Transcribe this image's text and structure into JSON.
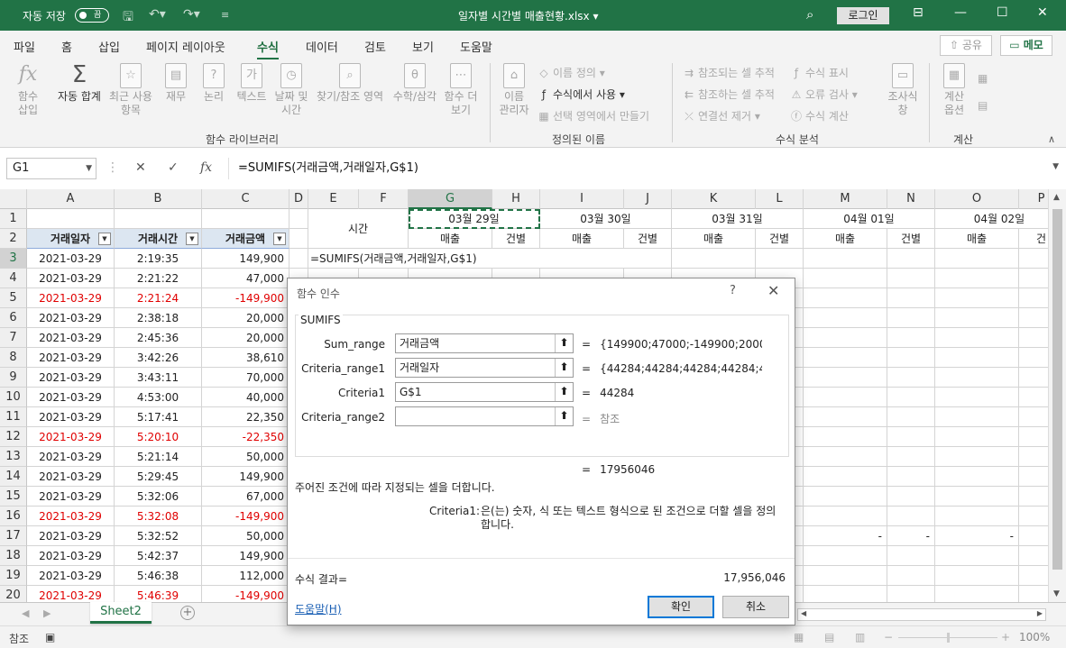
{
  "titlebar": {
    "autosave_label": "자동 저장",
    "autosave_state": "끔",
    "doc_title": "일자별 시간별 매출현황.xlsx ▾",
    "login": "로그인"
  },
  "tabs": [
    "파일",
    "홈",
    "삽입",
    "페이지 레이아웃",
    "수식",
    "데이터",
    "검토",
    "보기",
    "도움말"
  ],
  "active_tab": "수식",
  "share_label": "공유",
  "memo_label": "메모",
  "ribbon": {
    "insert_fn": "함수\n삽입",
    "autosum": "자동 합계",
    "recent": "최근 사용\n항목",
    "finance": "재무",
    "logic": "논리",
    "text": "텍스트",
    "datetime": "날짜 및\n시간",
    "lookup": "찾기/참조 영역",
    "math": "수학/삼각",
    "more": "함수 더\n보기",
    "group1": "함수 라이브러리",
    "name_mgr": "이름\n관리자",
    "define_name": "이름 정의",
    "use_in_formula": "수식에서 사용",
    "create_from_sel": "선택 영역에서 만들기",
    "group2": "정의된 이름",
    "trace_prec": "참조되는 셀 추적",
    "trace_dep": "참조하는 셀 추적",
    "remove_arrows": "연결선 제거",
    "show_formulas": "수식 표시",
    "error_check": "오류 검사",
    "evaluate": "수식 계산",
    "watch": "조사식\n창",
    "group3": "수식 분석",
    "calc_options": "계산\n옵션",
    "group4": "계산"
  },
  "formula_bar": {
    "name_box": "G1",
    "formula": "=SUMIFS(거래금액,거래일자,G$1)"
  },
  "columns": [
    "A",
    "B",
    "C",
    "D",
    "E",
    "F",
    "G",
    "H",
    "I",
    "J",
    "K",
    "L",
    "M",
    "N",
    "O",
    "P"
  ],
  "selected_column": "G",
  "header_row": {
    "time_label": "시간",
    "dates": [
      "03월 29일",
      "03월 30일",
      "03월 31일",
      "04월 01일",
      "04월 02일"
    ],
    "sales": "매출",
    "count": "건별",
    "count_partial": "건"
  },
  "table_headers": [
    "거래일자",
    "거래시간",
    "거래금액"
  ],
  "editing_cell_text": "=SUMIFS(거래금액,거래일자,G$1)",
  "rows": [
    {
      "n": "3",
      "date": "2021-03-29",
      "time": "2:19:35",
      "amt": "149,900",
      "neg": false
    },
    {
      "n": "4",
      "date": "2021-03-29",
      "time": "2:21:22",
      "amt": "47,000",
      "neg": false
    },
    {
      "n": "5",
      "date": "2021-03-29",
      "time": "2:21:24",
      "amt": "-149,900",
      "neg": true
    },
    {
      "n": "6",
      "date": "2021-03-29",
      "time": "2:38:18",
      "amt": "20,000",
      "neg": false
    },
    {
      "n": "7",
      "date": "2021-03-29",
      "time": "2:45:36",
      "amt": "20,000",
      "neg": false
    },
    {
      "n": "8",
      "date": "2021-03-29",
      "time": "3:42:26",
      "amt": "38,610",
      "neg": false
    },
    {
      "n": "9",
      "date": "2021-03-29",
      "time": "3:43:11",
      "amt": "70,000",
      "neg": false
    },
    {
      "n": "10",
      "date": "2021-03-29",
      "time": "4:53:00",
      "amt": "40,000",
      "neg": false
    },
    {
      "n": "11",
      "date": "2021-03-29",
      "time": "5:17:41",
      "amt": "22,350",
      "neg": false
    },
    {
      "n": "12",
      "date": "2021-03-29",
      "time": "5:20:10",
      "amt": "-22,350",
      "neg": true
    },
    {
      "n": "13",
      "date": "2021-03-29",
      "time": "5:21:14",
      "amt": "50,000",
      "neg": false
    },
    {
      "n": "14",
      "date": "2021-03-29",
      "time": "5:29:45",
      "amt": "149,900",
      "neg": false
    },
    {
      "n": "15",
      "date": "2021-03-29",
      "time": "5:32:06",
      "amt": "67,000",
      "neg": false
    },
    {
      "n": "16",
      "date": "2021-03-29",
      "time": "5:32:08",
      "amt": "-149,900",
      "neg": true
    },
    {
      "n": "17",
      "date": "2021-03-29",
      "time": "5:32:52",
      "amt": "50,000",
      "neg": false
    },
    {
      "n": "18",
      "date": "2021-03-29",
      "time": "5:42:37",
      "amt": "149,900",
      "neg": false
    },
    {
      "n": "19",
      "date": "2021-03-29",
      "time": "5:46:38",
      "amt": "112,000",
      "neg": false
    },
    {
      "n": "20",
      "date": "2021-03-29",
      "time": "5:46:39",
      "amt": "-149,900",
      "neg": true
    }
  ],
  "row17_dashes": [
    "-",
    "-",
    "-"
  ],
  "dialog": {
    "title": "함수 인수",
    "function": "SUMIFS",
    "args": [
      {
        "label": "Sum_range",
        "value": "거래금액",
        "result": "{149900;47000;-149900;20000;2"
      },
      {
        "label": "Criteria_range1",
        "value": "거래일자",
        "result": "{44284;44284;44284;44284;4428"
      },
      {
        "label": "Criteria1",
        "value": "G$1",
        "result": "44284"
      },
      {
        "label": "Criteria_range2",
        "value": "",
        "result": "참조"
      }
    ],
    "equals": "=",
    "total": "17956046",
    "description": "주어진 조건에 따라 지정되는 셀을 더합니다.",
    "arg_help_name": "Criteria1:",
    "arg_help_text": "은(는) 숫자, 식 또는 텍스트 형식으로 된 조건으로 더할 셀을 정의합니다.",
    "result_label": "수식 결과=",
    "result_value": "17,956,046",
    "help_link": "도움말(H)",
    "ok": "확인",
    "cancel": "취소"
  },
  "sheet_tab": "Sheet2",
  "status": {
    "mode": "참조",
    "zoom": "100%"
  }
}
